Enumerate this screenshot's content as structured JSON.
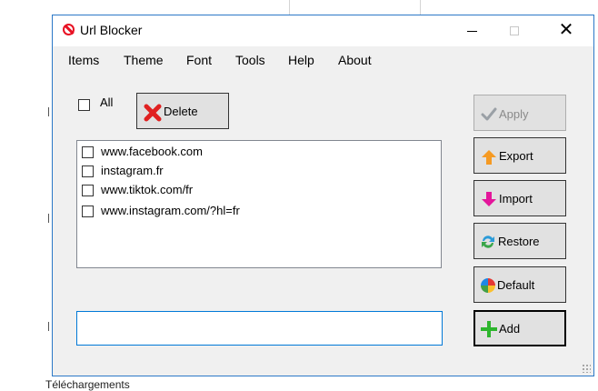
{
  "window": {
    "title": "Url Blocker",
    "close_glyph": "✕"
  },
  "menu": {
    "items": [
      "Items",
      "Theme",
      "Font",
      "Tools",
      "Help",
      "About"
    ]
  },
  "toolbar": {
    "all_label": "All",
    "all_checked": false,
    "delete_label": "Delete"
  },
  "url_list": [
    {
      "url": "www.facebook.com",
      "checked": false
    },
    {
      "url": "instagram.fr",
      "checked": false
    },
    {
      "url": "www.tiktok.com/fr",
      "checked": false
    },
    {
      "url": "www.instagram.com/?hl=fr",
      "checked": false
    }
  ],
  "url_input": {
    "value": ""
  },
  "actions": {
    "apply_label": "Apply",
    "export_label": "Export",
    "import_label": "Import",
    "restore_label": "Restore",
    "default_label": "Default",
    "add_label": "Add"
  },
  "background": {
    "taskbar_text": "Téléchargements"
  },
  "colors": {
    "accent": "#0078d7",
    "window_border": "#2b78c7",
    "blocker_red": "#e81123",
    "delete_red": "#e02020",
    "apply_gray": "#9aa0a6",
    "export_orange": "#f59a23",
    "import_magenta": "#e4169b",
    "add_green": "#2db52d"
  },
  "icons": {
    "app": "blocker-icon",
    "delete": "red-x-icon",
    "apply": "checkmark-icon",
    "export": "arrow-up-icon",
    "import": "arrow-down-icon",
    "restore": "refresh-icon",
    "default": "color-wheel-icon",
    "add": "plus-icon"
  }
}
